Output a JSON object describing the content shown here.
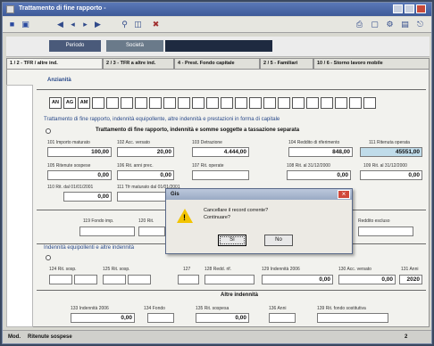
{
  "window": {
    "title": "Trattamento di fine rapporto - ",
    "colors": {
      "titlebar": "#3e5a98",
      "accent": "#2a4a8a",
      "dialog_close": "#d0483a",
      "highlight_field": "#c0dcea"
    }
  },
  "toolbar": {
    "icons": [
      "save-icon",
      "disk-icon",
      "first-record-icon",
      "prev-icon",
      "next-icon",
      "last-icon",
      "search-icon",
      "print-icon"
    ]
  },
  "header": {
    "periodo_label": "Periodo",
    "societa_label": "Società",
    "societa_value": ""
  },
  "tabs": [
    {
      "label": "1 / 2 - TFR / altre ind."
    },
    {
      "label": "2 / 3 - TFR a altre ind."
    },
    {
      "label": "4 - Prest. Fondo capitale"
    },
    {
      "label": "2 / 5 - Familiari"
    },
    {
      "label": "10 / 6 - Storno lavoro mobile"
    }
  ],
  "section1": {
    "title": "Anzianità",
    "boxes": [
      "AN",
      "AG",
      "AM",
      "",
      "",
      "",
      "",
      "",
      "",
      "",
      "",
      "",
      "",
      "",
      "",
      "",
      "",
      "",
      "",
      "",
      "",
      "",
      ""
    ]
  },
  "section2": {
    "title": "Trattamento di fine rapporto, indennità equipollente, altre indennità e prestazioni in forma di capitale",
    "subtitle": "Trattamento di fine rapporto, indennità e somme soggette a tassazione separata",
    "row1": {
      "labels": [
        "101 Importo maturato",
        "102 Acc. versato",
        "103 Detrazione",
        "104 Reddito di riferimento",
        "111 Ritenuta operata"
      ],
      "values": [
        "100,00",
        "20,00",
        "4.444,00",
        "848,00",
        "45551,00"
      ]
    },
    "row2": {
      "labels": [
        "105 Ritenute sospese",
        "106 Rit. anni prec.",
        "107 Rit. operate",
        "108 Rit. al 31/12/2000",
        "109 Rit. al 31/12/2000"
      ],
      "values": [
        "0,00",
        "0,00",
        "",
        "0,00",
        "0,00"
      ]
    },
    "row3": {
      "labels": [
        "110 Rit. dal 01/01/2001",
        "111 Tfr maturato dal 01/01/2001"
      ],
      "values": [
        "0,00",
        ""
      ]
    },
    "row4": {
      "labels": [
        "119 Fondo imp.",
        "120 Rit.",
        "",
        "Reddito escluso"
      ],
      "values": [
        "",
        "",
        "",
        ""
      ]
    }
  },
  "section3": {
    "title": "Indennità equipollenti e altre indennità",
    "labels": [
      "124 Rit. sosp.",
      "125 Rit. sosp.",
      "127",
      "128 Redd. rif.",
      "129 Indennità 2006",
      "130 Acc. versato",
      "131 Anni"
    ],
    "values": [
      "",
      "",
      "",
      "",
      "0,00",
      "0,00",
      "2020"
    ]
  },
  "section4": {
    "title": "Altre indennità",
    "labels": [
      "133 Indennità 2006",
      "134 Fondo",
      "135 Rit. sospesa",
      "136 Anni",
      "139 Rit. fondo sostitutiva"
    ],
    "values": [
      "0,00",
      "",
      "0,00",
      "",
      ""
    ]
  },
  "dialog": {
    "title": "Gis",
    "message_line1": "Cancellare il record corrente?",
    "message_line2": "Continuare?",
    "ok_label": "Sì",
    "no_label": "No"
  },
  "statusbar": {
    "field1": "Mod.",
    "field2": "Ritenute sospese",
    "field3": "2"
  }
}
